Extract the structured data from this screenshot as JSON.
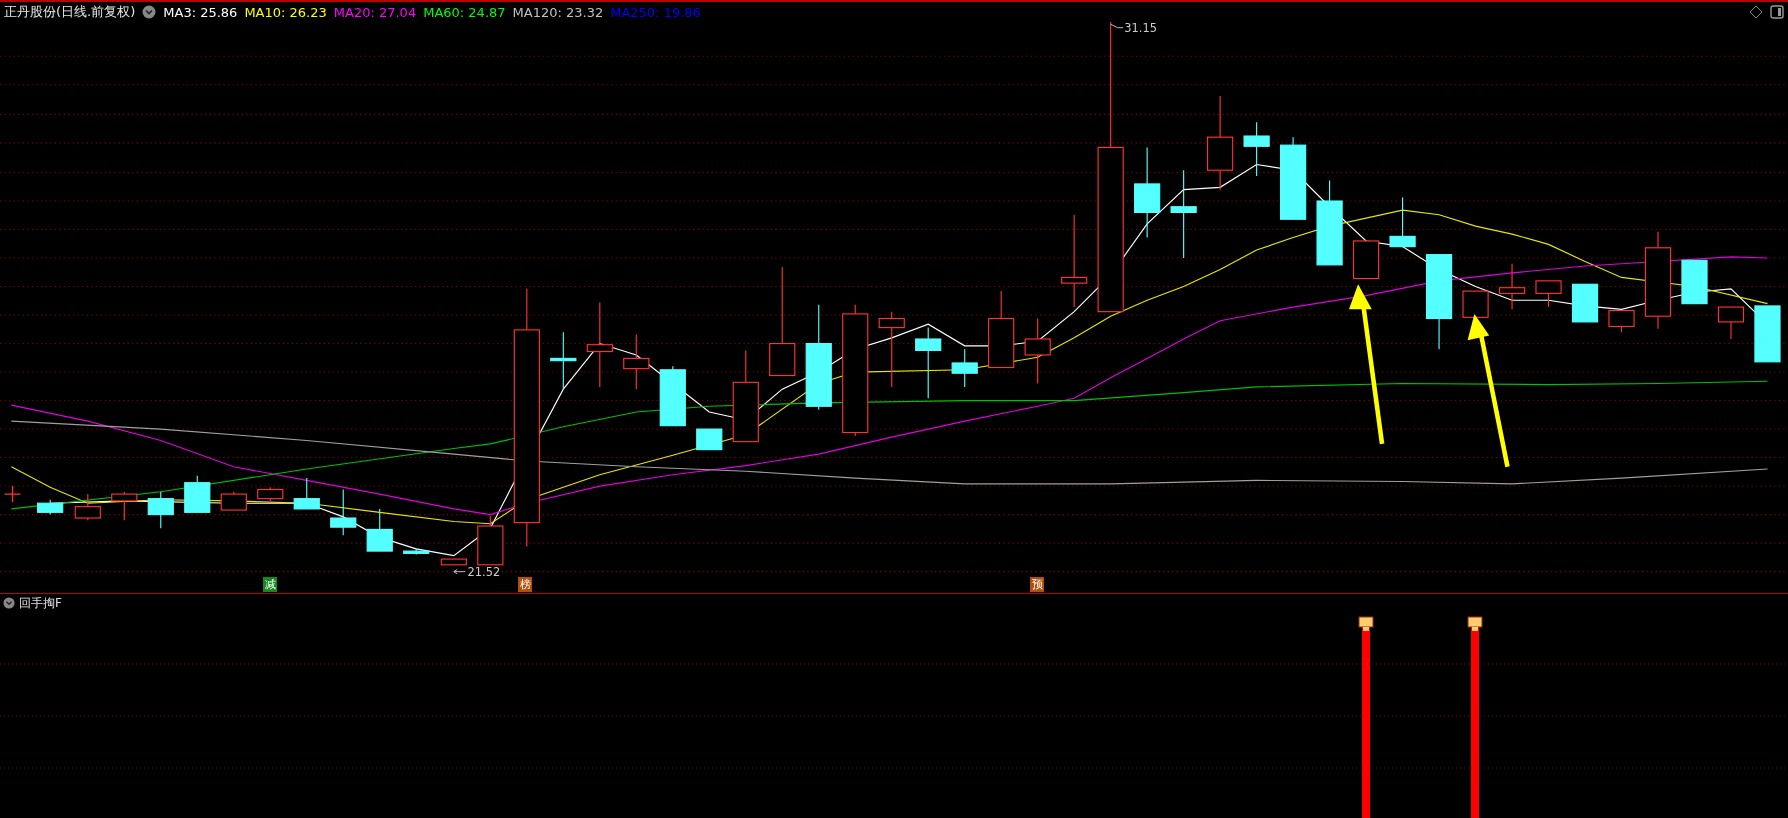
{
  "header": {
    "title": "正丹股份(日线.前复权)",
    "ma": [
      {
        "label": "MA3: 25.86",
        "color": "#ffffff"
      },
      {
        "label": "MA10: 26.23",
        "color": "#ffff00"
      },
      {
        "label": "MA20: 27.04",
        "color": "#ff00ff"
      },
      {
        "label": "MA60: 24.87",
        "color": "#00ff00"
      },
      {
        "label": "MA120: 23.32",
        "color": "#c0c0c0"
      },
      {
        "label": "MA250: 19.86",
        "color": "#0000ff"
      }
    ]
  },
  "price_chart": {
    "high_label": "31.15",
    "low_label": "21.52",
    "markers": [
      {
        "text": "减",
        "color": "#138a1e"
      },
      {
        "text": "榜",
        "color": "#b0500c"
      },
      {
        "text": "预",
        "color": "#b0500c"
      }
    ]
  },
  "indicator": {
    "title": "回手掏F"
  }
}
